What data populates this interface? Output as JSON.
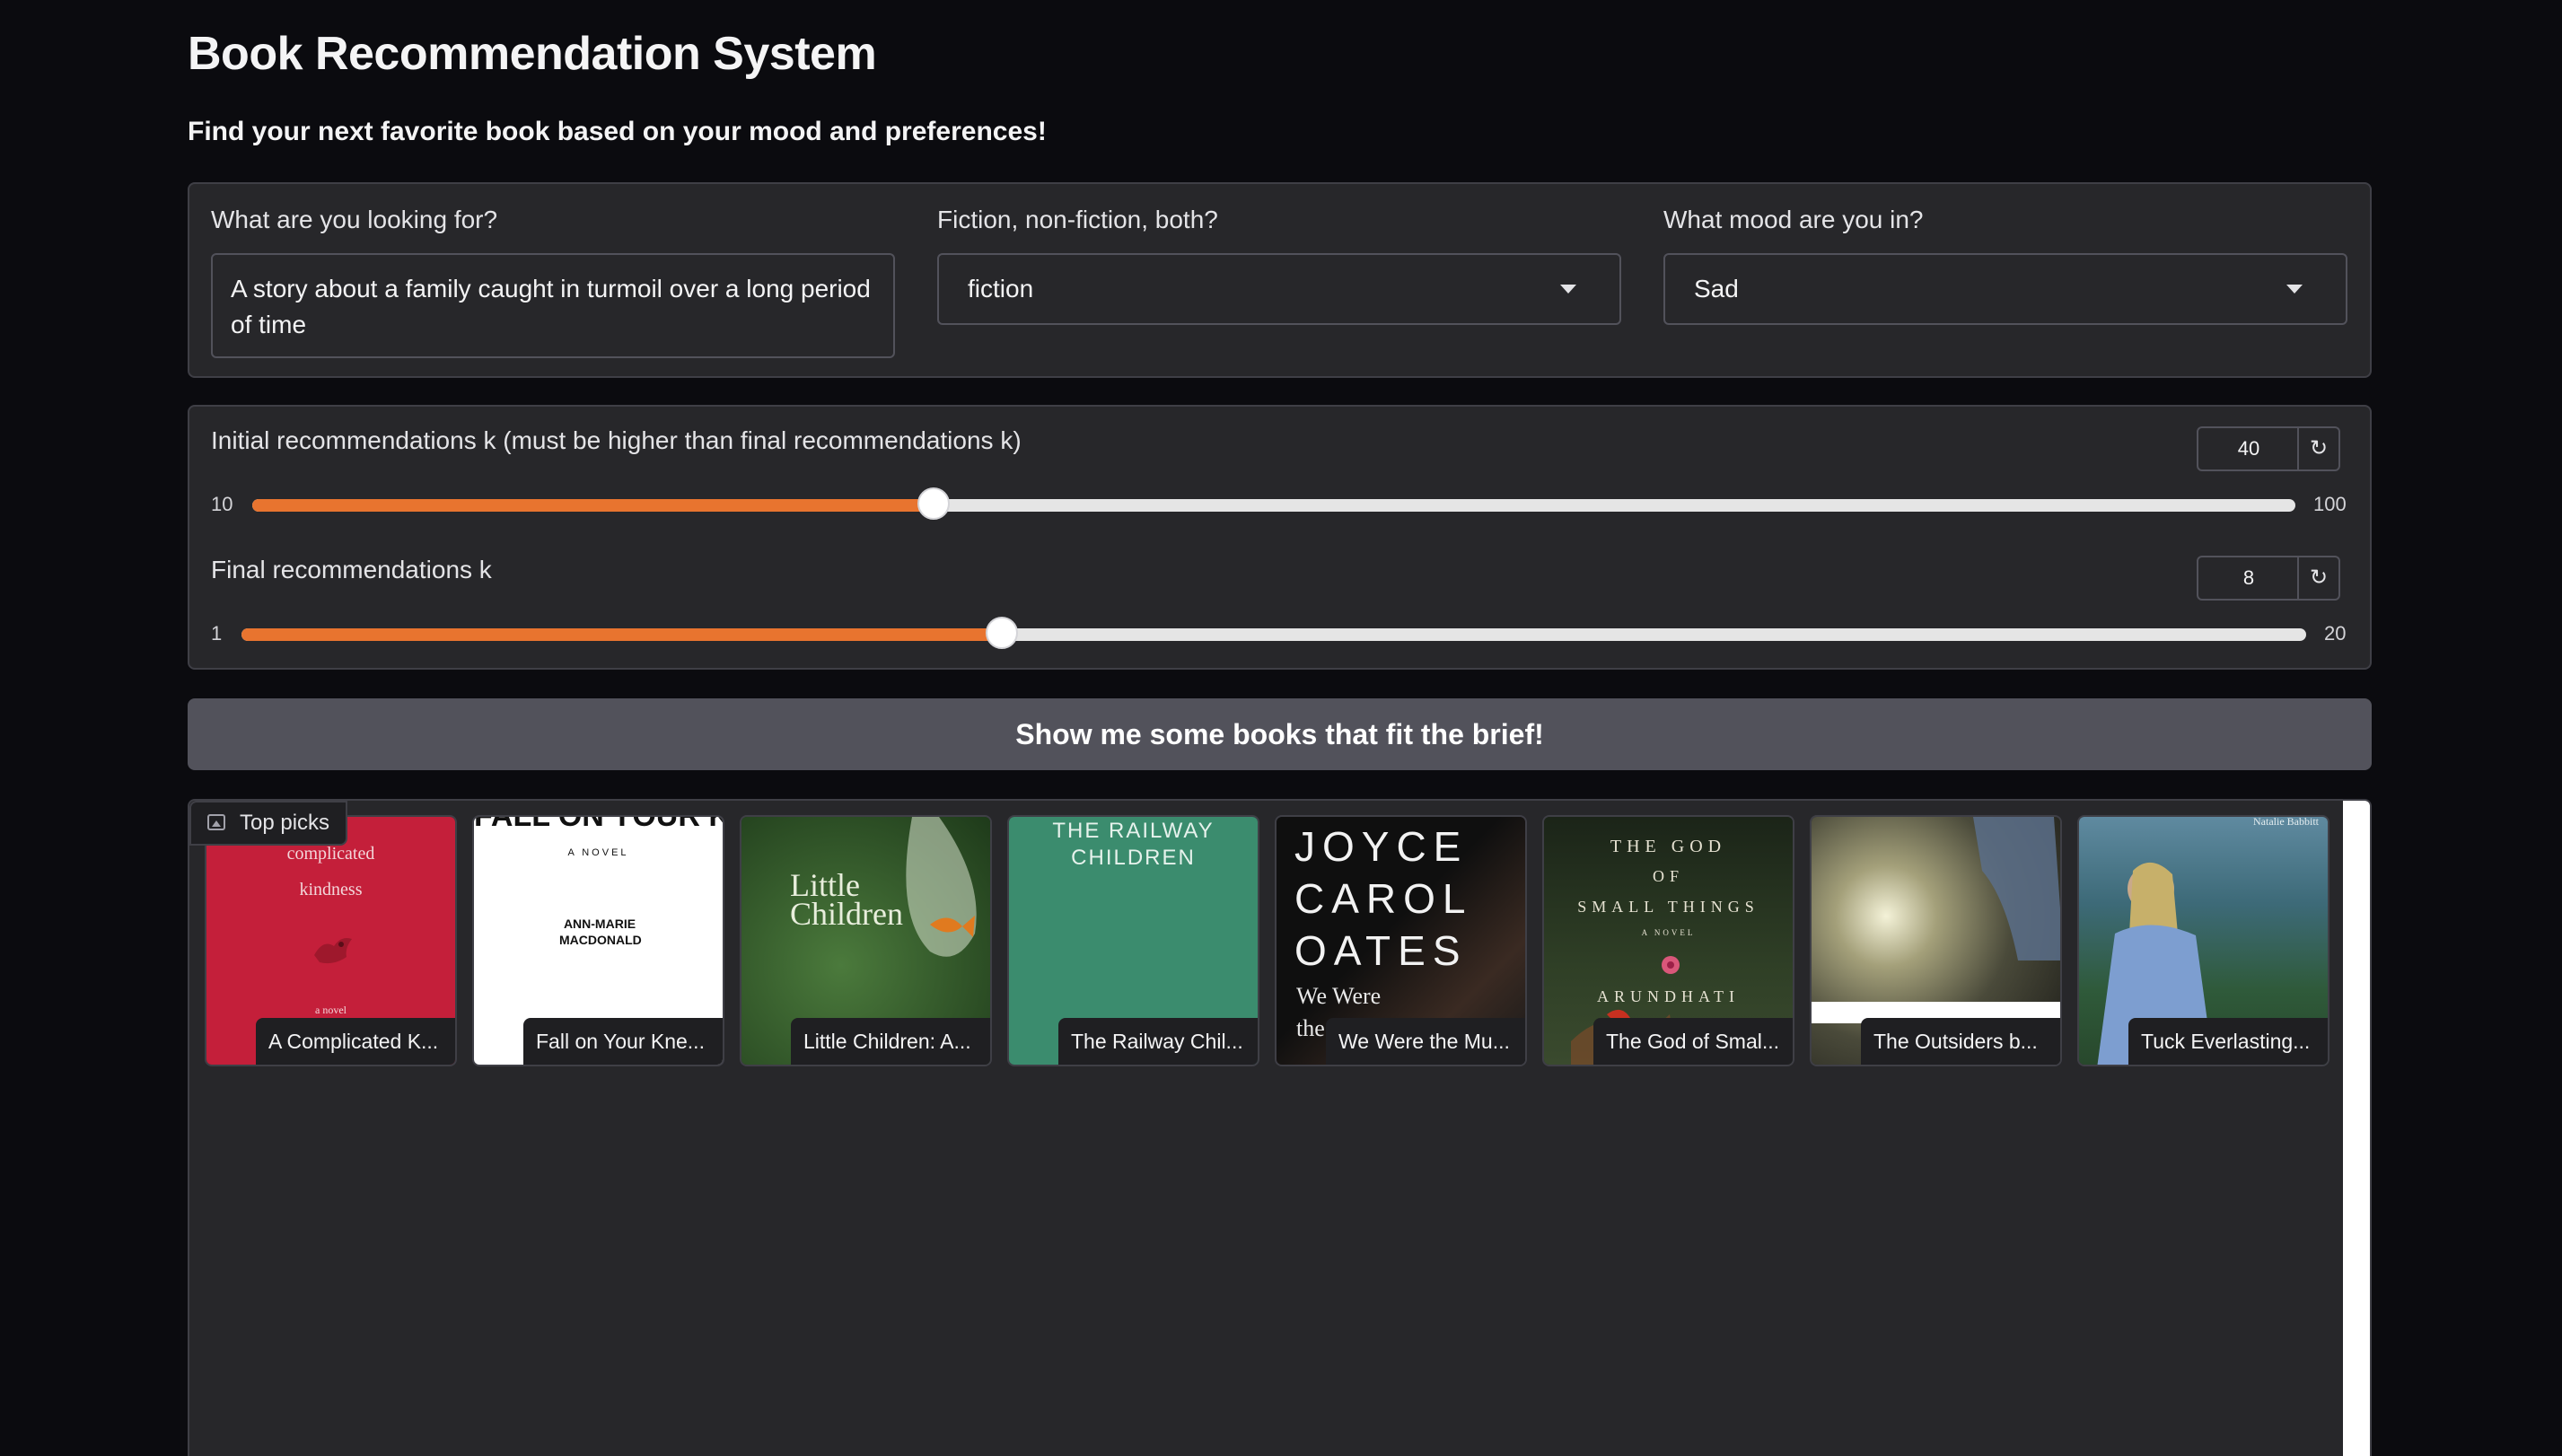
{
  "header": {
    "title": "Book Recommendation System",
    "subtitle": "Find your next favorite book based on your mood and preferences!"
  },
  "query": {
    "label": "What are you looking for?",
    "value": "A story about a family caught in turmoil over a long period of time"
  },
  "category": {
    "label": "Fiction, non-fiction, both?",
    "value": "fiction"
  },
  "mood": {
    "label": "What mood are you in?",
    "value": "Sad"
  },
  "initial_k": {
    "label": "Initial recommendations k (must be higher than final recommendations k)",
    "value": "40",
    "min": "10",
    "max": "100",
    "level": 0.3333
  },
  "final_k": {
    "label": "Final recommendations k",
    "value": "8",
    "min": "1",
    "max": "20",
    "level": 0.3684
  },
  "reset_icon": "↻",
  "submit_label": "Show me some books that fit the brief!",
  "gallery": {
    "label": "Top picks",
    "items": [
      {
        "caption": "A Complicated K...",
        "cover_texts": [
          "complicated",
          "kindness",
          "a novel"
        ],
        "color": "#c41f3a"
      },
      {
        "caption": "Fall on Your Kne...",
        "cover_texts": [
          "FALL ON YOUR KNEES",
          "A NOVEL",
          "ANN-MARIE MACDONALD"
        ],
        "color": "#ffffff"
      },
      {
        "caption": "Little Children: A...",
        "cover_texts": [
          "Little",
          "Children"
        ],
        "color": "#2f5b2a"
      },
      {
        "caption": "The Railway Chil...",
        "cover_texts": [
          "THE RAILWAY",
          "CHILDREN"
        ],
        "color": "#3b8c6e"
      },
      {
        "caption": "We Were the Mu...",
        "cover_texts": [
          "JOYCE",
          "CAROL",
          "OATES",
          "We Were",
          "the"
        ],
        "color": "#1a1a1a"
      },
      {
        "caption": "The God of Smal...",
        "cover_texts": [
          "THE GOD",
          "OF",
          "SMALL THINGS",
          "A NOVEL",
          "ARUNDHATI"
        ],
        "color": "#2a3a22"
      },
      {
        "caption": "The Outsiders b...",
        "cover_texts": [],
        "color": "#4a4a3a"
      },
      {
        "caption": "Tuck Everlasting...",
        "cover_texts": [
          "Natalie Babbitt"
        ],
        "color": "#3d6a78"
      }
    ]
  }
}
